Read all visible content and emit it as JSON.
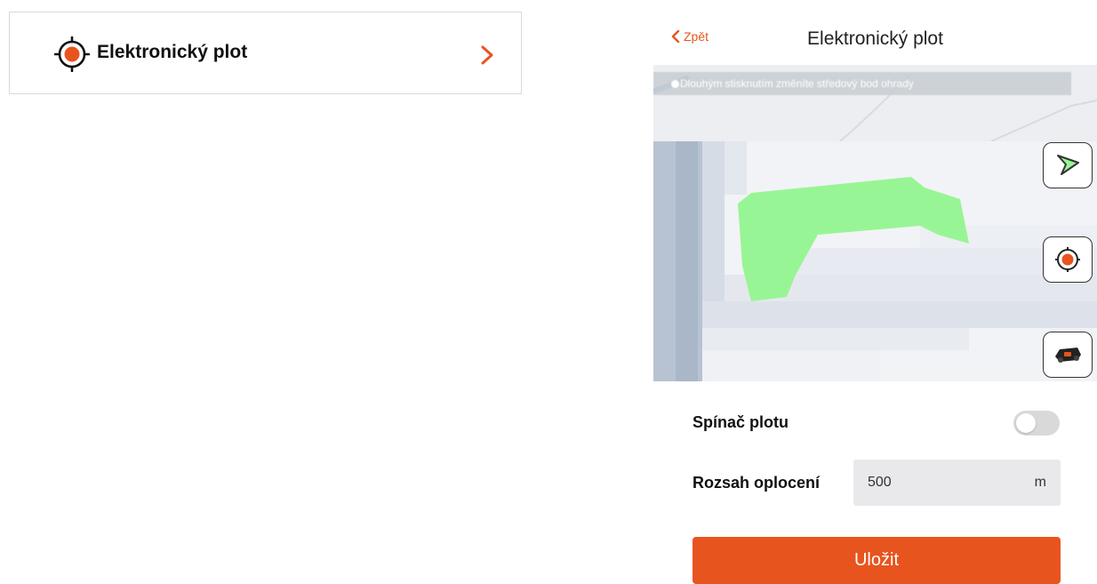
{
  "left_card": {
    "icon": "target-icon",
    "label": "Elektronický plot",
    "chevron": "chevron-right-icon"
  },
  "phone": {
    "header": {
      "back_label": "Zpět",
      "back_icon": "chevron-left-icon",
      "title": "Elektronický plot"
    },
    "map": {
      "hint_text": "Dlouhým stisknutím změníte středový bod ohrady",
      "tools": [
        {
          "name": "draw-fence-tool",
          "icon": "polygon-icon"
        },
        {
          "name": "center-point-tool",
          "icon": "target-icon"
        },
        {
          "name": "device-locate-tool",
          "icon": "device-icon"
        }
      ],
      "fence_color": "#98f595"
    },
    "settings": {
      "switch_label": "Spínač plotu",
      "switch_on": false,
      "range_label": "Rozsah oplocení",
      "range_value": "500",
      "range_unit": "m"
    },
    "save_label": "Uložit"
  },
  "colors": {
    "accent": "#e8541e",
    "toggle_off": "#d9d9d9",
    "input_bg": "#e9e9ec"
  }
}
